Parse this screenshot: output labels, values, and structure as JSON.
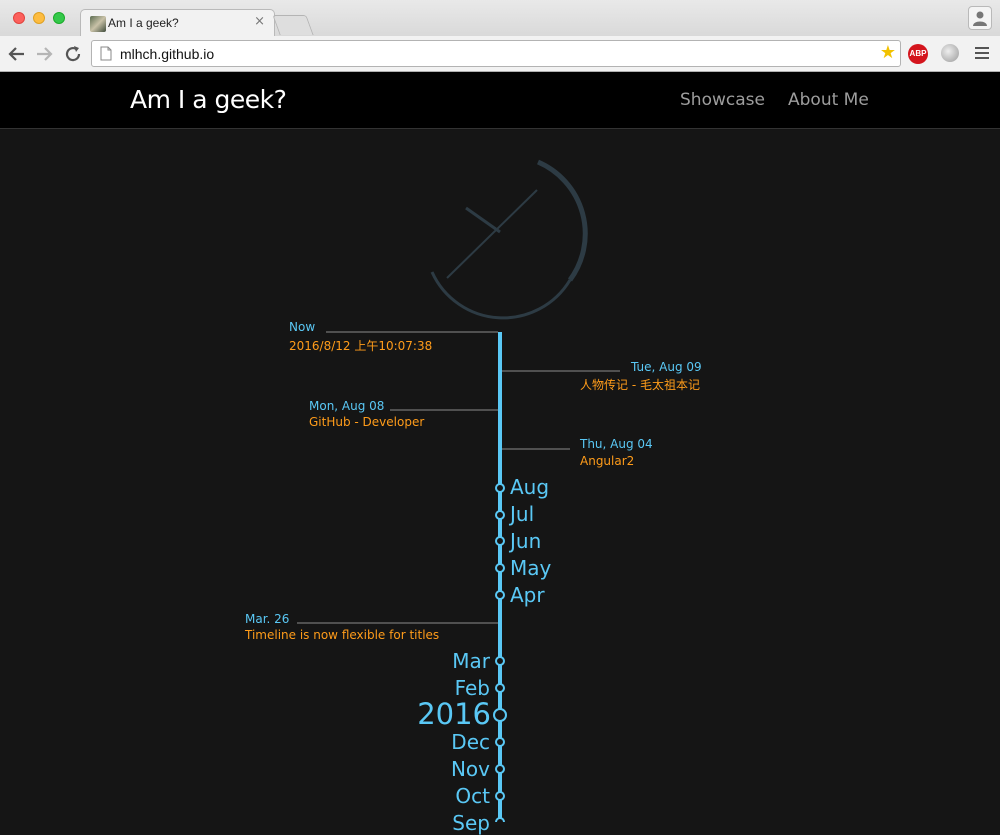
{
  "browser": {
    "tab_title": "Am I a geek?",
    "tab_close": "×",
    "url": "mlhch.github.io",
    "abp_label": "ABP"
  },
  "site": {
    "brand": "Am I a geek?",
    "nav": [
      {
        "label": "Showcase"
      },
      {
        "label": "About Me"
      }
    ]
  },
  "timeline": {
    "events": [
      {
        "title": "Now",
        "desc": "2016/8/12 上午10:07:38",
        "side": "left"
      },
      {
        "title": "Tue, Aug 09",
        "desc": "人物传记 - 毛太祖本记",
        "side": "right"
      },
      {
        "title": "Mon, Aug 08",
        "desc": "GitHub - Developer",
        "side": "left"
      },
      {
        "title": "Thu, Aug 04",
        "desc": "Angular2",
        "side": "right"
      },
      {
        "title": "Mar. 26",
        "desc": "Timeline is now flexible for titles",
        "side": "left"
      }
    ],
    "months": [
      "Aug",
      "Jul",
      "Jun",
      "May",
      "Apr",
      "Mar",
      "Feb",
      "2016",
      "Dec",
      "Nov",
      "Oct",
      "Sep"
    ]
  },
  "colors": {
    "accent": "#5ac8f5",
    "event_desc": "#ff9c1a",
    "background": "#151515",
    "navbar": "#000000"
  }
}
